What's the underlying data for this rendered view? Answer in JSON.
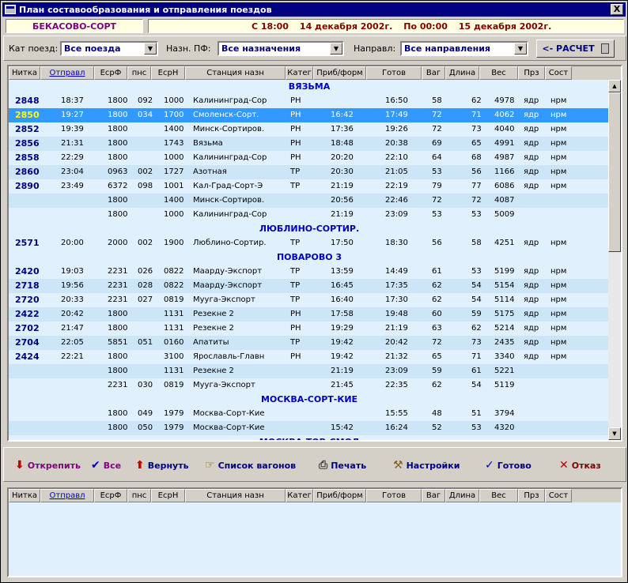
{
  "window": {
    "title": "План составообразования и отправления поездов",
    "close": "X"
  },
  "station": "БЕКАСОВО-СОРТ",
  "period": {
    "from_time": "С 18:00",
    "from_date": "14 декабря 2002г.",
    "to_time": "По 00:00",
    "to_date": "15 декабря 2002г."
  },
  "filters": {
    "cat_label": "Кат поезд:",
    "cat_value": "Все поезда",
    "dest_label": "Назн. ПФ:",
    "dest_value": "Все назначения",
    "dir_label": "Направл:",
    "dir_value": "Все направления",
    "calc_label": "<- РАСЧЕТ"
  },
  "columns": [
    "Нитка",
    "Отправл",
    "ЕсрФ",
    "пнс",
    "ЕсрН",
    "Станция назн",
    "Катег",
    "Приб/форм",
    "Готов",
    "Ваг",
    "Длина",
    "Вес",
    "Прз",
    "Сост"
  ],
  "rows": [
    {
      "g": "ВЯЗЬМА"
    },
    {
      "c": [
        "2848",
        "18:37",
        "1800",
        "092",
        "1000",
        "Калининград-Сор",
        "РН",
        "",
        "16:50",
        "58",
        "62",
        "4978",
        "ядр",
        "нрм"
      ]
    },
    {
      "c": [
        "2850",
        "19:27",
        "1800",
        "034",
        "1700",
        "Смоленск-Сорт.",
        "РН",
        "16:42",
        "17:49",
        "72",
        "71",
        "4062",
        "ядр",
        "нрм"
      ],
      "sel": true
    },
    {
      "c": [
        "2852",
        "19:39",
        "1800",
        "",
        "1400",
        "Минск-Сортиров.",
        "РН",
        "17:36",
        "19:26",
        "72",
        "73",
        "4040",
        "ядр",
        "нрм"
      ]
    },
    {
      "c": [
        "2856",
        "21:31",
        "1800",
        "",
        "1743",
        "Вязьма",
        "РН",
        "18:48",
        "20:38",
        "69",
        "65",
        "4991",
        "ядр",
        "нрм"
      ]
    },
    {
      "c": [
        "2858",
        "22:29",
        "1800",
        "",
        "1000",
        "Калининград-Сор",
        "РН",
        "20:20",
        "22:10",
        "64",
        "68",
        "4987",
        "ядр",
        "нрм"
      ]
    },
    {
      "c": [
        "2860",
        "23:04",
        "0963",
        "002",
        "1727",
        "Азотная",
        "ТР",
        "20:30",
        "21:05",
        "53",
        "56",
        "1166",
        "ядр",
        "нрм"
      ]
    },
    {
      "c": [
        "2890",
        "23:49",
        "6372",
        "098",
        "1001",
        "Кал-Град-Сорт-Э",
        "ТР",
        "21:19",
        "22:19",
        "79",
        "77",
        "6086",
        "ядр",
        "нрм"
      ]
    },
    {
      "c": [
        "",
        "",
        "1800",
        "",
        "1400",
        "Минск-Сортиров.",
        "",
        "20:56",
        "22:46",
        "72",
        "72",
        "4087",
        "",
        ""
      ]
    },
    {
      "c": [
        "",
        "",
        "1800",
        "",
        "1000",
        "Калининград-Сор",
        "",
        "21:19",
        "23:09",
        "53",
        "53",
        "5009",
        "",
        ""
      ]
    },
    {
      "g": "ЛЮБЛИНО-СОРТИР."
    },
    {
      "c": [
        "2571",
        "20:00",
        "2000",
        "002",
        "1900",
        "Люблино-Сортир.",
        "ТР",
        "17:50",
        "18:30",
        "56",
        "58",
        "4251",
        "ядр",
        "нрм"
      ]
    },
    {
      "g": "ПОВАРОВО 3"
    },
    {
      "c": [
        "2420",
        "19:03",
        "2231",
        "026",
        "0822",
        "Маарду-Экспорт",
        "ТР",
        "13:59",
        "14:49",
        "61",
        "53",
        "5199",
        "ядр",
        "нрм"
      ]
    },
    {
      "c": [
        "2718",
        "19:56",
        "2231",
        "028",
        "0822",
        "Маарду-Экспорт",
        "ТР",
        "16:45",
        "17:35",
        "62",
        "54",
        "5154",
        "ядр",
        "нрм"
      ]
    },
    {
      "c": [
        "2720",
        "20:33",
        "2231",
        "027",
        "0819",
        "Мууга-Экспорт",
        "ТР",
        "16:40",
        "17:30",
        "62",
        "54",
        "5114",
        "ядр",
        "нрм"
      ]
    },
    {
      "c": [
        "2422",
        "20:42",
        "1800",
        "",
        "1131",
        "Резекне 2",
        "РН",
        "17:58",
        "19:48",
        "60",
        "59",
        "5175",
        "ядр",
        "нрм"
      ]
    },
    {
      "c": [
        "2702",
        "21:47",
        "1800",
        "",
        "1131",
        "Резекне 2",
        "РН",
        "19:29",
        "21:19",
        "63",
        "62",
        "5214",
        "ядр",
        "нрм"
      ]
    },
    {
      "c": [
        "2704",
        "22:05",
        "5851",
        "051",
        "0160",
        "Апатиты",
        "ТР",
        "19:42",
        "20:42",
        "72",
        "73",
        "2435",
        "ядр",
        "нрм"
      ]
    },
    {
      "c": [
        "2424",
        "22:21",
        "1800",
        "",
        "3100",
        "Ярославль-Главн",
        "РН",
        "19:42",
        "21:32",
        "65",
        "71",
        "3340",
        "ядр",
        "нрм"
      ]
    },
    {
      "c": [
        "",
        "",
        "1800",
        "",
        "1131",
        "Резекне 2",
        "",
        "21:19",
        "23:09",
        "59",
        "61",
        "5221",
        "",
        ""
      ]
    },
    {
      "c": [
        "",
        "",
        "2231",
        "030",
        "0819",
        "Мууга-Экспорт",
        "",
        "21:45",
        "22:35",
        "62",
        "54",
        "5119",
        "",
        ""
      ]
    },
    {
      "g": "МОСКВА-СОРТ-КИЕ"
    },
    {
      "c": [
        "",
        "",
        "1800",
        "049",
        "1979",
        "Москва-Сорт-Кие",
        "",
        "",
        "15:55",
        "48",
        "51",
        "3794",
        "",
        ""
      ]
    },
    {
      "c": [
        "",
        "",
        "1800",
        "050",
        "1979",
        "Москва-Сорт-Кие",
        "",
        "15:42",
        "16:24",
        "52",
        "53",
        "4320",
        "",
        ""
      ]
    },
    {
      "g": "МОСКВА-ТОВ-СМОЛ"
    }
  ],
  "toolbar": [
    {
      "label": "Открепить",
      "icon": "arrow-down-icon",
      "color": "#800080",
      "sym": "⬇",
      "iconColor": "#c00000"
    },
    {
      "label": "Все",
      "icon": "check-all-icon",
      "color": "#800080",
      "sym": "✔",
      "iconColor": "#0000c0"
    },
    {
      "label": "Вернуть",
      "icon": "arrow-up-icon",
      "color": "#000080",
      "sym": "⬆",
      "iconColor": "#c00000"
    },
    {
      "label": "Список вагонов",
      "icon": "hand-list-icon",
      "color": "#000080",
      "sym": "☞",
      "iconColor": "#806000"
    },
    {
      "label": "Печать",
      "icon": "printer-icon",
      "color": "#000080",
      "sym": "⎙",
      "iconColor": "#404040"
    },
    {
      "label": "Настройки",
      "icon": "hammer-icon",
      "color": "#000080",
      "sym": "⚒",
      "iconColor": "#806020"
    },
    {
      "label": "Готово",
      "icon": "check-icon",
      "color": "#000080",
      "sym": "✓",
      "iconColor": "#0000c0"
    },
    {
      "label": "Отказ",
      "icon": "cross-icon",
      "color": "#800000",
      "sym": "✕",
      "iconColor": "#c00000"
    }
  ]
}
